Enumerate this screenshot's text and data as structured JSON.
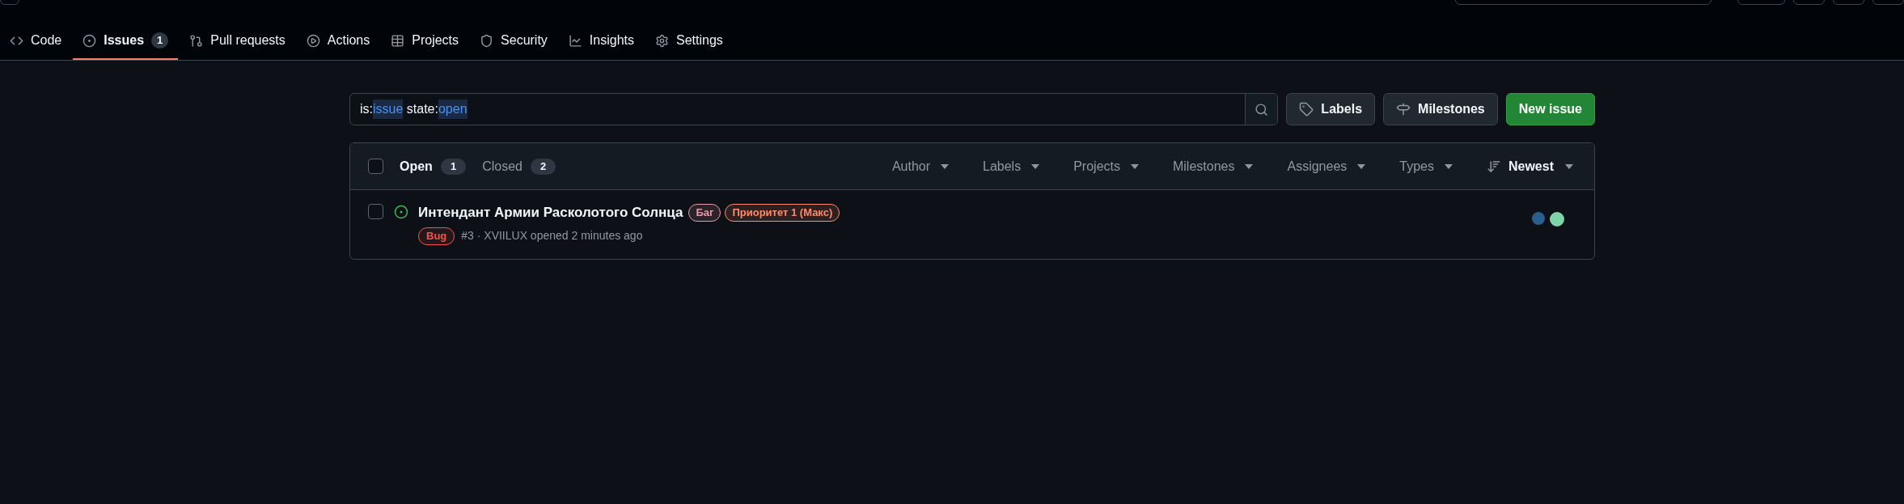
{
  "repo_tabs": [
    {
      "label": "Code",
      "kind": "code",
      "selected": false
    },
    {
      "label": "Issues",
      "kind": "issues",
      "count": "1",
      "selected": true
    },
    {
      "label": "Pull requests",
      "kind": "pulls",
      "selected": false
    },
    {
      "label": "Actions",
      "kind": "actions",
      "selected": false
    },
    {
      "label": "Projects",
      "kind": "projects",
      "selected": false
    },
    {
      "label": "Security",
      "kind": "security",
      "selected": false
    },
    {
      "label": "Insights",
      "kind": "insights",
      "selected": false
    },
    {
      "label": "Settings",
      "kind": "settings",
      "selected": false
    }
  ],
  "search": {
    "tokens": [
      {
        "text": "is:",
        "kind": "key"
      },
      {
        "text": "issue",
        "kind": "value"
      },
      {
        "text": " state:",
        "kind": "key"
      },
      {
        "text": "open",
        "kind": "value"
      }
    ]
  },
  "actions": [
    {
      "label": "Labels",
      "kind": "labels"
    },
    {
      "label": "Milestones",
      "kind": "milestones"
    },
    {
      "label": "New issue",
      "kind": "primary"
    }
  ],
  "issue_list": {
    "select_all": {
      "checked": false
    },
    "states": [
      {
        "label": "Open",
        "count": "1",
        "selected": true
      },
      {
        "label": "Closed",
        "count": "2",
        "selected": false
      }
    ],
    "filters": [
      {
        "label": "Author"
      },
      {
        "label": "Labels"
      },
      {
        "label": "Projects"
      },
      {
        "label": "Milestones"
      },
      {
        "label": "Assignees"
      },
      {
        "label": "Types"
      }
    ],
    "sort": {
      "label": "Newest"
    },
    "issues": [
      {
        "checked": false,
        "title": "Интендант Армии Расколотого Солнца",
        "labels": [
          {
            "text": "Баг",
            "color": "#e89aa8"
          },
          {
            "text": "Приоритет 1 (Макс)",
            "color": "#ff8a6b"
          }
        ],
        "type": {
          "text": "Bug",
          "color": "#f85149"
        },
        "meta": "#3 · XVIILUX opened 2 minutes ago"
      }
    ]
  }
}
